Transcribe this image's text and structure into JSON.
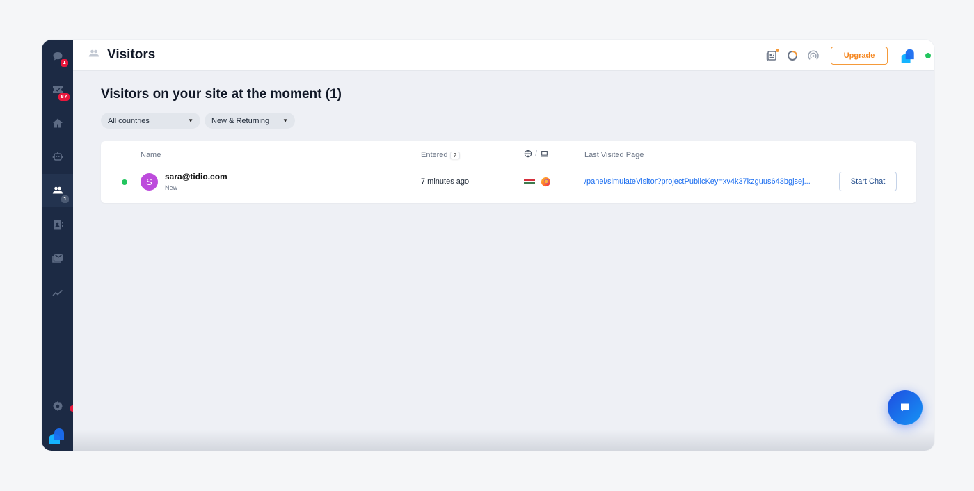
{
  "sidebar": {
    "items": [
      {
        "name": "conversations",
        "icon": "chat-bubble-icon",
        "badge": "1"
      },
      {
        "name": "tickets",
        "icon": "ticket-icon",
        "badge": "87"
      },
      {
        "name": "home",
        "icon": "home-icon",
        "badge": null
      },
      {
        "name": "bots",
        "icon": "bot-icon",
        "badge": null
      },
      {
        "name": "visitors",
        "icon": "visitors-icon",
        "badge": "1",
        "active": true
      },
      {
        "name": "contacts",
        "icon": "contacts-icon",
        "badge": null
      },
      {
        "name": "mailing",
        "icon": "mail-icon",
        "badge": null
      },
      {
        "name": "analytics",
        "icon": "analytics-icon",
        "badge": null
      }
    ],
    "settings_icon": "gear-icon",
    "logo": "tidio-logo"
  },
  "topbar": {
    "title": "Visitors",
    "upgrade_label": "Upgrade",
    "status": "online"
  },
  "main": {
    "heading": "Visitors on your site at the moment (1)",
    "filters": [
      {
        "label": "All countries"
      },
      {
        "label": "New & Returning"
      }
    ],
    "table": {
      "columns": {
        "name": "Name",
        "entered": "Entered",
        "entered_help": "?",
        "separator": "/",
        "last_page": "Last Visited Page"
      },
      "rows": [
        {
          "online": true,
          "avatar_letter": "S",
          "name": "sara@tidio.com",
          "status": "New",
          "entered": "7 minutes ago",
          "country": "Hungary",
          "browser": "Firefox",
          "last_page": "/panel/simulateVisitor?projectPublicKey=xv4k37kzguus643bgjsej...",
          "action_label": "Start Chat"
        }
      ]
    }
  },
  "colors": {
    "sidebar": "#1c2a44",
    "accent": "#1a6df0",
    "upgrade": "#f5861f",
    "badge": "#e8173c",
    "online": "#22c55e",
    "avatar": "#bd4bdc"
  }
}
